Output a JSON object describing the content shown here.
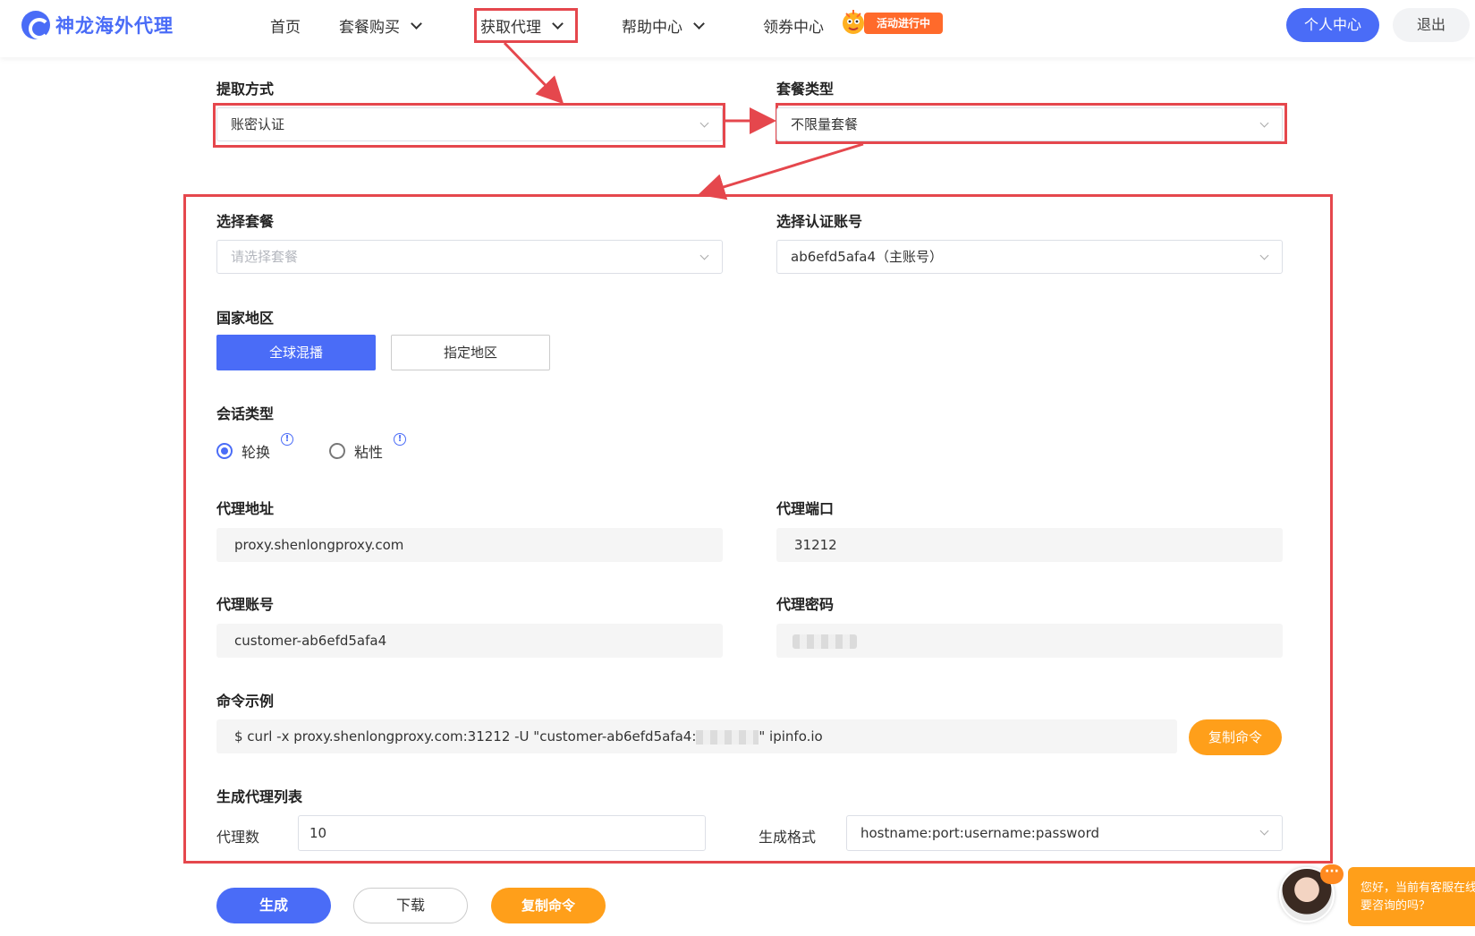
{
  "header": {
    "logo_text": "神龙海外代理",
    "nav": [
      {
        "label": "首页"
      },
      {
        "label": "套餐购买"
      },
      {
        "label": "获取代理"
      },
      {
        "label": "帮助中心"
      },
      {
        "label": "领券中心"
      }
    ],
    "promo_badge": "活动进行中",
    "user_center": "个人中心",
    "logout": "退出"
  },
  "form": {
    "extract_method": {
      "label": "提取方式",
      "value": "账密认证"
    },
    "package_type": {
      "label": "套餐类型",
      "value": "不限量套餐"
    },
    "select_package": {
      "label": "选择套餐",
      "placeholder": "请选择套餐"
    },
    "select_account": {
      "label": "选择认证账号",
      "value": "ab6efd5afa4（主账号）"
    },
    "region": {
      "label": "国家地区",
      "options": [
        "全球混播",
        "指定地区"
      ],
      "selected": "全球混播"
    },
    "session": {
      "label": "会话类型",
      "options": [
        "轮换",
        "粘性"
      ],
      "selected": "轮换",
      "info_icon": "!"
    },
    "proxy_address": {
      "label": "代理地址",
      "value": "proxy.shenlongproxy.com"
    },
    "proxy_port": {
      "label": "代理端口",
      "value": "31212"
    },
    "proxy_account": {
      "label": "代理账号",
      "value": "customer-ab6efd5afa4"
    },
    "proxy_password": {
      "label": "代理密码"
    },
    "command": {
      "label": "命令示例",
      "prefix": "$ curl -x proxy.shenlongproxy.com:31212 -U \"customer-ab6efd5afa4:",
      "suffix": "\" ipinfo.io",
      "copy_label": "复制命令"
    },
    "generate_list": {
      "label": "生成代理列表",
      "count_label": "代理数",
      "count_value": "10",
      "format_label": "生成格式",
      "format_value": "hostname:port:username:password"
    }
  },
  "actions": {
    "generate": "生成",
    "download": "下载",
    "copy": "复制命令"
  },
  "chat": {
    "dots": "···",
    "line1": "您好，当前有客服在线",
    "line2": "要咨询的吗？"
  },
  "colors": {
    "primary": "#4a6cf7",
    "orange": "#ff9f1a",
    "annotation_red": "#e5474d"
  }
}
